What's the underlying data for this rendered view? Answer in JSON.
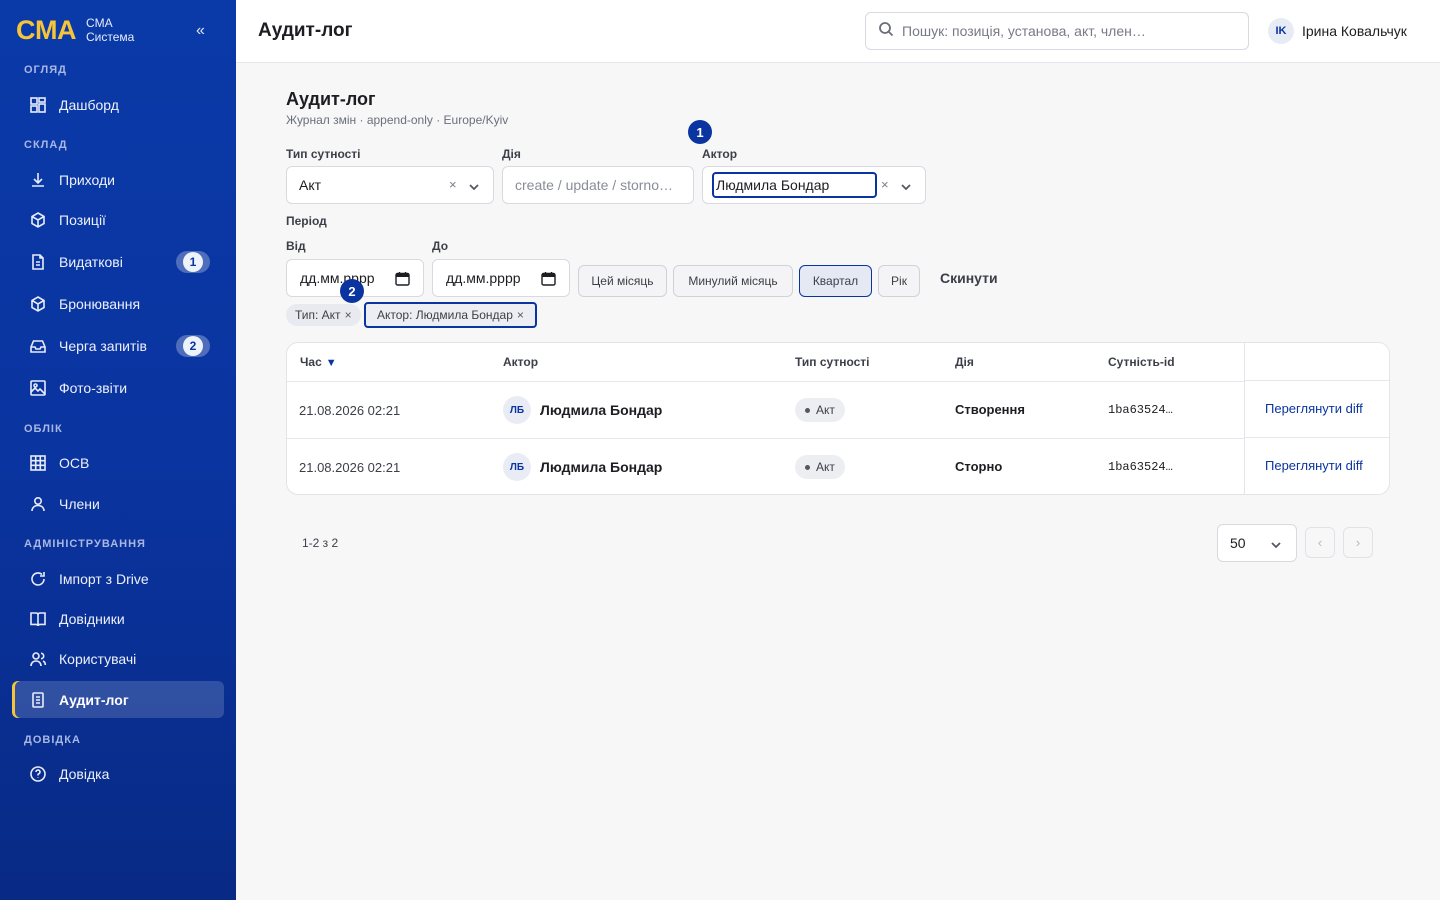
{
  "brand": {
    "logo": "CMA",
    "line1": "CMA",
    "line2": "Система",
    "collapse": "«"
  },
  "sidebar": {
    "sections": [
      "ОГЛЯД",
      "СКЛАД",
      "ОБЛІК",
      "АДМІНІСТРУВАННЯ",
      "ДОВІДКА"
    ],
    "items": [
      {
        "label": "Дашборд",
        "icon": "dashboard-icon"
      },
      {
        "label": "Приходи",
        "icon": "download-icon"
      },
      {
        "label": "Позиції",
        "icon": "box-icon"
      },
      {
        "label": "Видаткові",
        "icon": "document-icon",
        "badge": "1"
      },
      {
        "label": "Бронювання",
        "icon": "box-icon"
      },
      {
        "label": "Черга запитів",
        "icon": "inbox-icon",
        "badge": "2"
      },
      {
        "label": "Фото-звіти",
        "icon": "image-icon"
      },
      {
        "label": "ОСВ",
        "icon": "grid-icon"
      },
      {
        "label": "Члени",
        "icon": "user-icon"
      },
      {
        "label": "Імпорт з Drive",
        "icon": "refresh-icon"
      },
      {
        "label": "Довідники",
        "icon": "book-icon"
      },
      {
        "label": "Користувачі",
        "icon": "users-icon"
      },
      {
        "label": "Аудит-лог",
        "icon": "audit-icon",
        "active": true
      },
      {
        "label": "Довідка",
        "icon": "help-icon"
      }
    ]
  },
  "header": {
    "title": "Аудит-лог",
    "search_placeholder": "Пошук: позиція, установа, акт, член…",
    "user_initials": "IK",
    "user_name": "Ірина Ковальчук"
  },
  "main": {
    "title": "Аудит-лог",
    "subtitle": "Журнал змін · append-only · Europe/Kyiv",
    "filters": {
      "entity_type_label": "Тип сутності",
      "entity_type_value": "Акт",
      "action_label": "Дія",
      "action_placeholder": "create / update / storno…",
      "actor_label": "Актор",
      "actor_value": "Людмила Бондар",
      "period_label": "Період",
      "from_label": "Від",
      "to_label": "До",
      "date_placeholder": "дд.мм.рррр",
      "presets": [
        "Цей місяць",
        "Минулий місяць",
        "Квартал",
        "Рік"
      ],
      "active_preset": "Квартал",
      "reset": "Скинути",
      "clear": "×"
    },
    "markers": [
      "1",
      "2"
    ],
    "active_tags": [
      "Тип: Акт",
      "Актор: Людмила Бондар"
    ],
    "table": {
      "columns": [
        "Час",
        "Актор",
        "Тип сутності",
        "Дія",
        "Сутність-id"
      ],
      "sort_indicator": "▼",
      "rows": [
        {
          "time": "21.08.2026 02:21",
          "actor_initials": "ЛБ",
          "actor": "Людмила Бондар",
          "type": "Акт",
          "action": "Створення",
          "id": "1ba63524…",
          "link": "Переглянути diff"
        },
        {
          "time": "21.08.2026 02:21",
          "actor_initials": "ЛБ",
          "actor": "Людмила Бондар",
          "type": "Акт",
          "action": "Сторно",
          "id": "1ba63524…",
          "link": "Переглянути diff"
        }
      ]
    },
    "pagination": {
      "info": "1-2 з 2",
      "page_size": "50",
      "prev": "‹",
      "next": "›"
    }
  }
}
